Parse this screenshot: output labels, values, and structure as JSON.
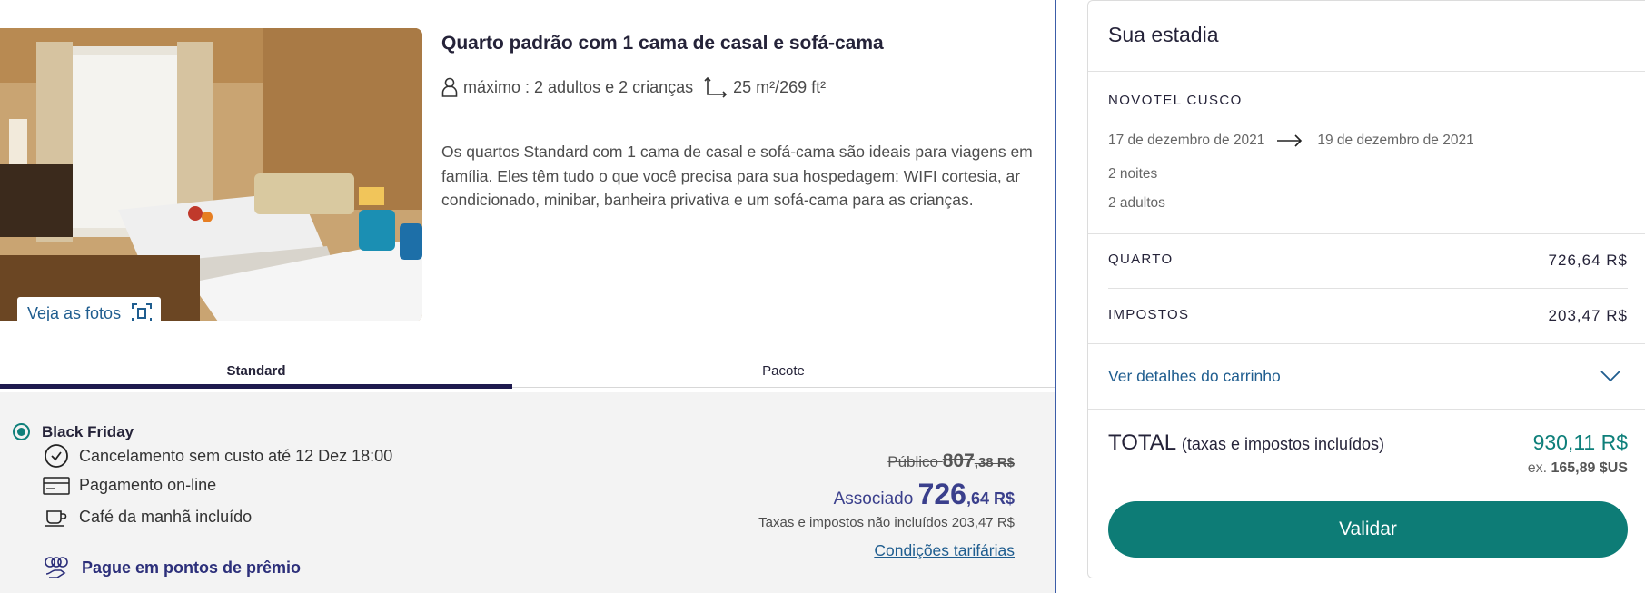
{
  "room": {
    "title": "Quarto padrão com 1 cama de casal e sofá-cama",
    "capacity": "máximo : 2 adultos e 2 crianças",
    "size": "25 m²/269 ft²",
    "description": "Os quartos Standard com 1 cama de casal e sofá-cama são ideais para viagens em família. Eles têm tudo o que você precisa para sua hospedagem: WIFI cortesia, ar condicionado, minibar, banheira privativa e um sofá-cama para as crianças.",
    "photos_button": "Veja as fotos"
  },
  "tabs": [
    {
      "label": "Standard",
      "active": true
    },
    {
      "label": "Pacote",
      "active": false
    }
  ],
  "rate": {
    "name": "Black Friday",
    "selected": true,
    "features": [
      {
        "icon": "clock-icon",
        "label": "Cancelamento sem custo até 12 Dez 18:00"
      },
      {
        "icon": "credit-card-icon",
        "label": "Pagamento on-line"
      },
      {
        "icon": "coffee-cup-icon",
        "label": "Café da manhã incluído"
      }
    ],
    "points_link": "Pague em pontos de prêmio",
    "public_label": "Público",
    "public_price_int": "807",
    "public_price_cents": ",38 R$",
    "member_label": "Associado",
    "member_price_int": "726",
    "member_price_cents": ",64 R$",
    "taxes_note": "Taxas e impostos não incluídos 203,47 R$",
    "conditions_link": "Condições tarifárias"
  },
  "stay": {
    "title": "Sua estadia",
    "hotel": "NOVOTEL CUSCO",
    "checkin": "17 de dezembro de 2021",
    "checkout": "19 de dezembro de 2021",
    "nights": "2 noites",
    "adults": "2 adultos",
    "room_label": "QUARTO",
    "room_value": "726,64 R$",
    "taxes_label": "IMPOSTOS",
    "taxes_value": "203,47 R$",
    "cart_details": "Ver detalhes do carrinho",
    "total_label": "TOTAL",
    "total_sub": "(taxas e impostos incluídos)",
    "total_value": "930,11 R$",
    "usd_prefix": "ex.",
    "usd_value": "165,89 $US",
    "validate_button": "Validar"
  },
  "colors": {
    "brand_navy": "#1e1a4e",
    "teal": "#0d7c76",
    "link_blue": "#1f5d8f",
    "member_price": "#3a3f8c"
  }
}
